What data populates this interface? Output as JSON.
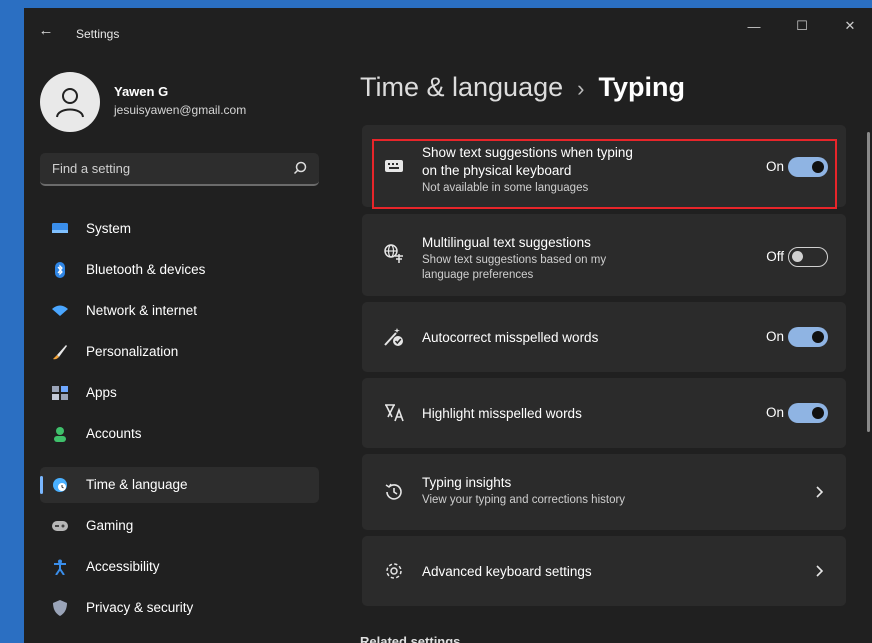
{
  "window": {
    "title": "Settings",
    "back_icon": "back-arrow-icon"
  },
  "controls": {
    "minimize": "—",
    "maximize": "☐",
    "close": "✕"
  },
  "profile": {
    "name": "Yawen G",
    "email": "jesuisyawen@gmail.com",
    "avatar_icon": "person-icon"
  },
  "search": {
    "placeholder": "Find a setting",
    "value": "",
    "icon": "search-icon"
  },
  "nav": {
    "items": [
      {
        "label": "System",
        "icon": "system-icon",
        "color": "#3a8eea"
      },
      {
        "label": "Bluetooth & devices",
        "icon": "bluetooth-icon",
        "color": "#2f86e6"
      },
      {
        "label": "Network & internet",
        "icon": "wifi-icon",
        "color": "#4aa6ff"
      },
      {
        "label": "Personalization",
        "icon": "brush-icon",
        "color": "#f2a33a"
      },
      {
        "label": "Apps",
        "icon": "apps-icon",
        "color": "#9aa4b8"
      },
      {
        "label": "Accounts",
        "icon": "accounts-icon",
        "color": "#3fc06b"
      },
      {
        "label": "Time & language",
        "icon": "globe-clock-icon",
        "color": "#4ab0ff",
        "active": true
      },
      {
        "label": "Gaming",
        "icon": "gamepad-icon",
        "color": "#b8b8b8"
      },
      {
        "label": "Accessibility",
        "icon": "accessibility-icon",
        "color": "#3a8eea"
      },
      {
        "label": "Privacy & security",
        "icon": "shield-icon",
        "color": "#9aa4b8"
      }
    ]
  },
  "page": {
    "breadcrumb": "Time & language",
    "separator": "›",
    "title": "Typing"
  },
  "settings": [
    {
      "title_line1": "Show text suggestions when typing",
      "title_line2": "on the physical keyboard",
      "subtitle": "Not available in some languages",
      "state": "On",
      "icon": "keyboard-icon",
      "control": "toggle"
    },
    {
      "title_line1": "Multilingual text suggestions",
      "subtitle_line1": "Show text suggestions based on my",
      "subtitle_line2": "language preferences",
      "state": "Off",
      "icon": "language-icon",
      "control": "toggle"
    },
    {
      "title_line1": "Autocorrect misspelled words",
      "state": "On",
      "icon": "autocorrect-icon",
      "control": "toggle"
    },
    {
      "title_line1": "Highlight misspelled words",
      "state": "On",
      "icon": "highlight-text-icon",
      "control": "toggle"
    },
    {
      "title_line1": "Typing insights",
      "subtitle": "View your typing and corrections history",
      "icon": "history-icon",
      "control": "chevron"
    },
    {
      "title_line1": "Advanced keyboard settings",
      "icon": "gear-icon",
      "control": "chevron"
    }
  ],
  "related": {
    "heading": "Related settings"
  },
  "colors": {
    "accent": "#8fb4e3",
    "highlight_border": "#e8252a",
    "background": "#202020",
    "card": "#2b2b2b"
  }
}
